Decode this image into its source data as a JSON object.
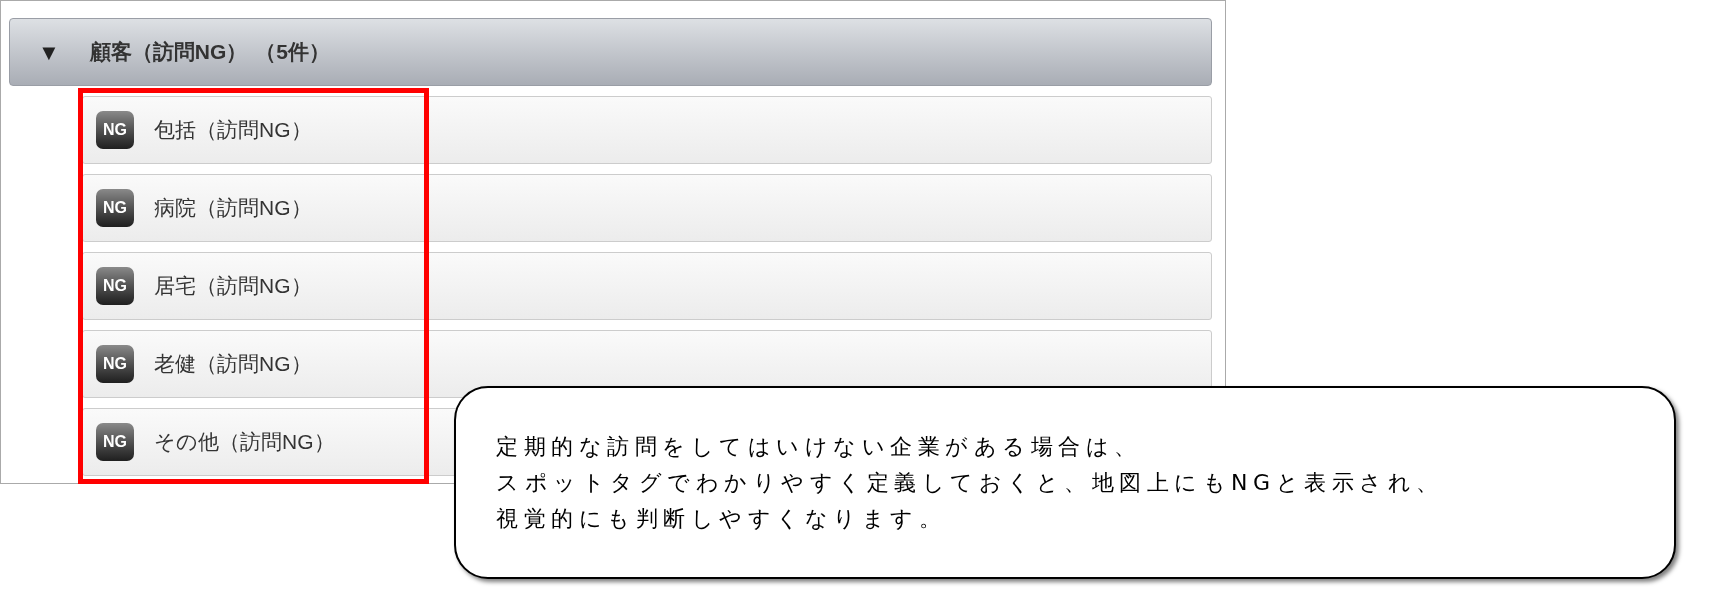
{
  "group": {
    "expanded": true,
    "toggle": "▼",
    "title": "顧客（訪問NG）",
    "count": "（5件）",
    "items": [
      {
        "badge": "NG",
        "label": "包括（訪問NG）"
      },
      {
        "badge": "NG",
        "label": "病院（訪問NG）"
      },
      {
        "badge": "NG",
        "label": "居宅（訪問NG）"
      },
      {
        "badge": "NG",
        "label": "老健（訪問NG）"
      },
      {
        "badge": "NG",
        "label": "その他（訪問NG）"
      }
    ]
  },
  "callout": {
    "lines": [
      "定期的な訪問をしてはいけない企業がある場合は、",
      "スポットタグでわかりやすく定義しておくと、地図上にもNGと表示され、",
      "視覚的にも判断しやすくなります。"
    ]
  }
}
